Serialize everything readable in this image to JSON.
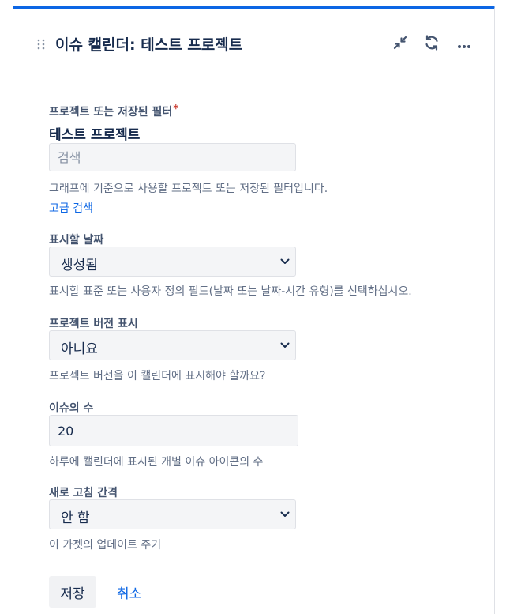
{
  "header": {
    "title": "이슈 캘린더: 테스트 프로젝트",
    "actions": [
      "minimize-icon",
      "refresh-icon",
      "more-icon"
    ]
  },
  "form": {
    "project": {
      "label": "프로젝트 또는 저장된 필터",
      "required_mark": "*",
      "selected": "테스트 프로젝트",
      "search_placeholder": "검색",
      "help": "그래프에 기준으로 사용할 프로젝트 또는 저장된 필터입니다.",
      "advanced_link": "고급 검색"
    },
    "date_field": {
      "label": "표시할 날짜",
      "value": "생성됨",
      "help": "표시할 표준 또는 사용자 정의 필드(날짜 또는 날짜-시간 유형)를 선택하십시오."
    },
    "versions": {
      "label": "프로젝트 버전 표시",
      "value": "아니요",
      "help": "프로젝트 버전을 이 캘린더에 표시해야 할까요?"
    },
    "issue_count": {
      "label": "이슈의 수",
      "value": "20",
      "help": "하루에 캘린더에 표시된 개별 이슈 아이콘의 수"
    },
    "refresh": {
      "label": "새로 고침 간격",
      "value": "안 함",
      "help": "이 가젯의 업데이트 주기"
    },
    "save_label": "저장",
    "cancel_label": "취소"
  },
  "colors": {
    "accent": "#0c66e4",
    "required": "#c9372c",
    "field_bg": "#f4f5f7"
  }
}
